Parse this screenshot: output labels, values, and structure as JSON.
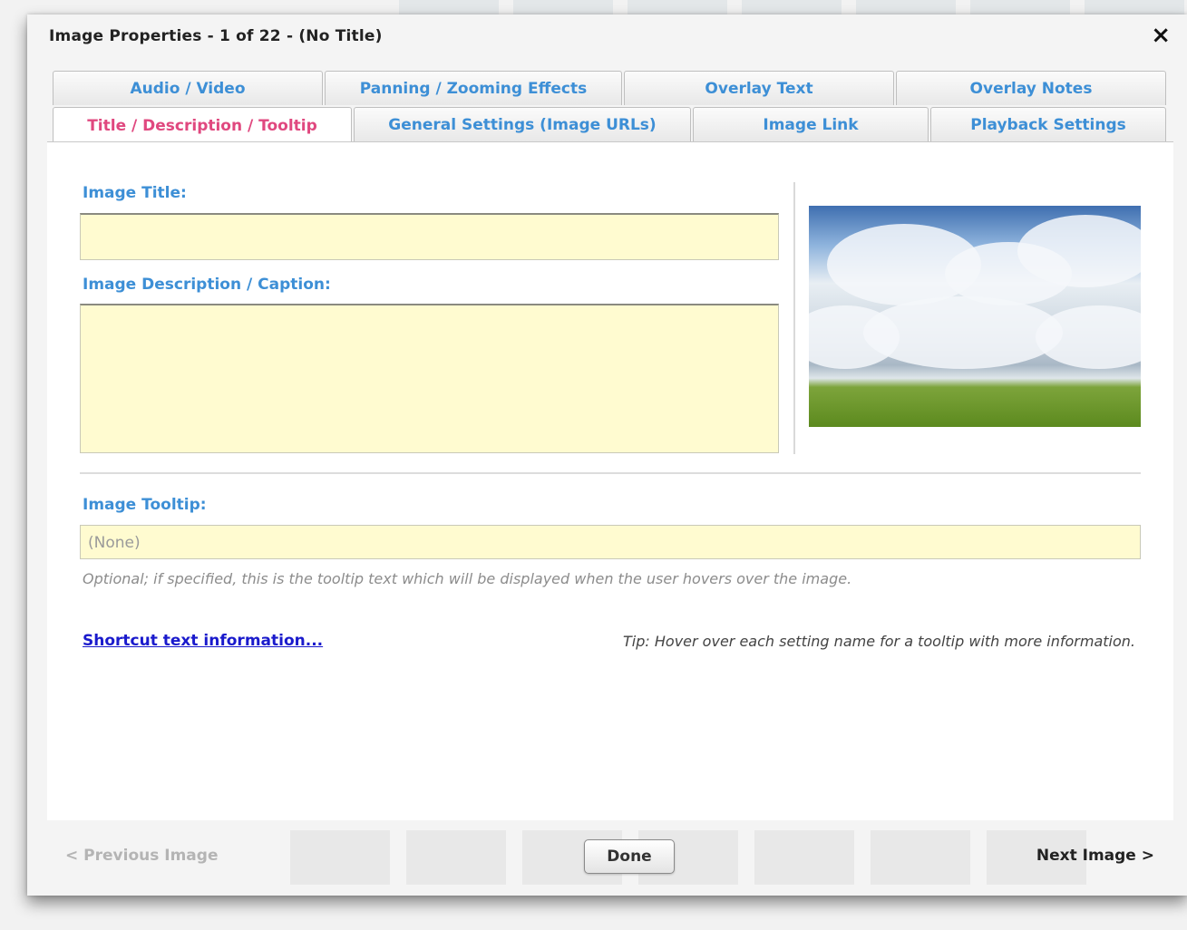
{
  "dialog": {
    "title": "Image Properties - 1 of 22 - (No Title)",
    "close_label": "×"
  },
  "tabs": {
    "row1": [
      {
        "label": "Audio / Video"
      },
      {
        "label": "Panning / Zooming Effects"
      },
      {
        "label": "Overlay Text"
      },
      {
        "label": "Overlay Notes"
      }
    ],
    "row2": [
      {
        "label": "Title / Description / Tooltip",
        "active": true
      },
      {
        "label": "General Settings (Image URLs)"
      },
      {
        "label": "Image Link"
      },
      {
        "label": "Playback Settings"
      }
    ]
  },
  "form": {
    "title_label": "Image Title:",
    "title_value": "",
    "description_label": "Image Description / Caption:",
    "description_value": "",
    "tooltip_label": "Image Tooltip:",
    "tooltip_placeholder": "(None)",
    "tooltip_hint": "Optional; if specified, this is the tooltip text which will be displayed when the user hovers over the image."
  },
  "links": {
    "shortcut": "Shortcut text information..."
  },
  "tip": "Tip: Hover over each setting name for a tooltip with more information.",
  "footer": {
    "prev_label": "< Previous Image",
    "done_label": "Done",
    "next_label": "Next Image >"
  },
  "colors": {
    "accent": "#3d8fd6",
    "active_tab": "#e0487f",
    "field_bg": "#fffbd0"
  }
}
